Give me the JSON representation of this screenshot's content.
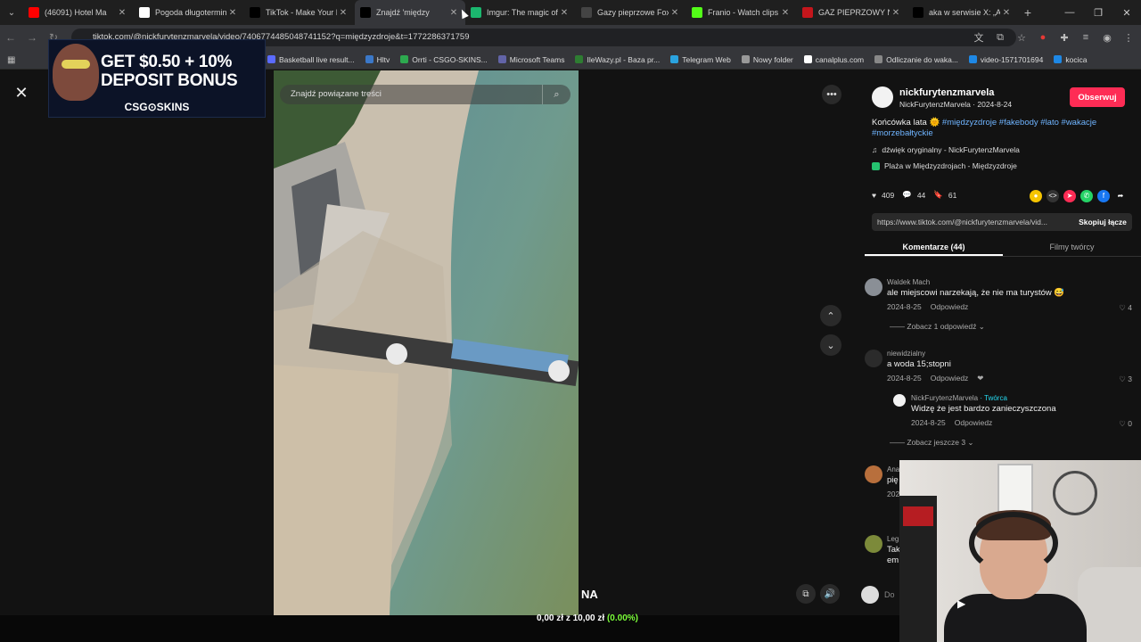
{
  "browser": {
    "tabs": [
      {
        "title": "(46091) Hotel Ma",
        "favicon_color": "#ff0000",
        "active": false
      },
      {
        "title": "Pogoda długotermin",
        "favicon_color": "#ffffff",
        "active": false
      },
      {
        "title": "TikTok - Make Your D",
        "favicon_color": "#000000",
        "active": false
      },
      {
        "title": "Znajdź 'między",
        "favicon_color": "#000000",
        "active": true
      },
      {
        "title": "Imgur: The magic of",
        "favicon_color": "#1bb76e",
        "active": false
      },
      {
        "title": "Gazy pieprzowe Fox",
        "favicon_color": "#444444",
        "active": false
      },
      {
        "title": "Franio - Watch clips",
        "favicon_color": "#53fc18",
        "active": false
      },
      {
        "title": "GAZ PIEPRZOWY NA",
        "favicon_color": "#c4161c",
        "active": false
      },
      {
        "title": "aka w serwisie X: „A",
        "favicon_color": "#000000",
        "active": false
      }
    ],
    "url": "tiktok.com/@nickfurytenzmarvela/video/7406774485048741152?q=międzyzdroje&t=1772286371759",
    "bookmarks": [
      {
        "label": "Basketball live result...",
        "color": "#5b6bff"
      },
      {
        "label": "Hltv",
        "color": "#3b78c8"
      },
      {
        "label": "Orrti - CSGO-SKINS...",
        "color": "#2da94f"
      },
      {
        "label": "Microsoft Teams",
        "color": "#6264a7"
      },
      {
        "label": "IleWazy.pl - Baza pr...",
        "color": "#2e7d32"
      },
      {
        "label": "Telegram Web",
        "color": "#2aa3df"
      },
      {
        "label": "Nowy folder",
        "color": "#999999"
      },
      {
        "label": "canalplus.com",
        "color": "#ffffff"
      },
      {
        "label": "Odliczanie do waka...",
        "color": "#888888"
      },
      {
        "label": "video-1571701694",
        "color": "#1e88e5"
      },
      {
        "label": "kocica",
        "color": "#1e88e5"
      }
    ]
  },
  "ad": {
    "headline": "GET $0.50 + 10% DEPOSIT BONUS",
    "brand": "CSG⊙SKINS"
  },
  "video": {
    "search_placeholder": "Znajdź powiązane treści",
    "overlay_text": "NA"
  },
  "post": {
    "username": "nickfurytenzmarvela",
    "display_and_date": "NickFurytenzMarvela · 2024-8-24",
    "follow_label": "Obserwuj",
    "caption": "Końcówka lata",
    "hashtags": "#międzyzdroje #fakebody #lato #wakacje #morzebałtyckie",
    "sound": "dźwięk oryginalny - NickFurytenzMarvela",
    "place": "Plaża w Międzyzdrojach - Międzyzdroje",
    "likes": "409",
    "comments": "44",
    "saves": "61",
    "link": "https://www.tiktok.com/@nickfurytenzmarvela/vid...",
    "copy_label": "Skopiuj łącze",
    "tab_comments": "Komentarze (44)",
    "tab_creator": "Filmy twórcy"
  },
  "comments": [
    {
      "name": "Waldek Mach",
      "text": "ale miejscowi narzekają, że nie ma turystów 😅",
      "date": "2024-8-25",
      "reply": "Odpowiedz",
      "likes": "4",
      "more": "Zobacz 1 odpowiedź"
    },
    {
      "name": "niewidzialny",
      "text": "a woda 15;stopni",
      "date": "2024-8-25",
      "reply": "Odpowiedz",
      "likes": "3"
    },
    {
      "name": "NickFurytenzMarvela",
      "creator_tag": "· Twórca",
      "text": "Widzę że jest bardzo zanieczyszczona",
      "date": "2024-8-25",
      "reply": "Odpowiedz",
      "likes": "0",
      "more": "Zobacz jeszcze 3"
    },
    {
      "name": "Ana",
      "text": "pię",
      "date": "202",
      "likes": ""
    },
    {
      "name": "Leg",
      "text": "Tak",
      "text2": "em",
      "likes": ""
    }
  ],
  "stream_overlay": {
    "money_current": "0,00 zł",
    "money_sep": "z",
    "money_goal": "10,00 zł",
    "money_pct": "(0.00%)"
  },
  "colors": {
    "follow": "#fe2c55",
    "hashtag": "#6fb4ff",
    "creator": "#25d9f0",
    "percent": "#7cff3a"
  }
}
